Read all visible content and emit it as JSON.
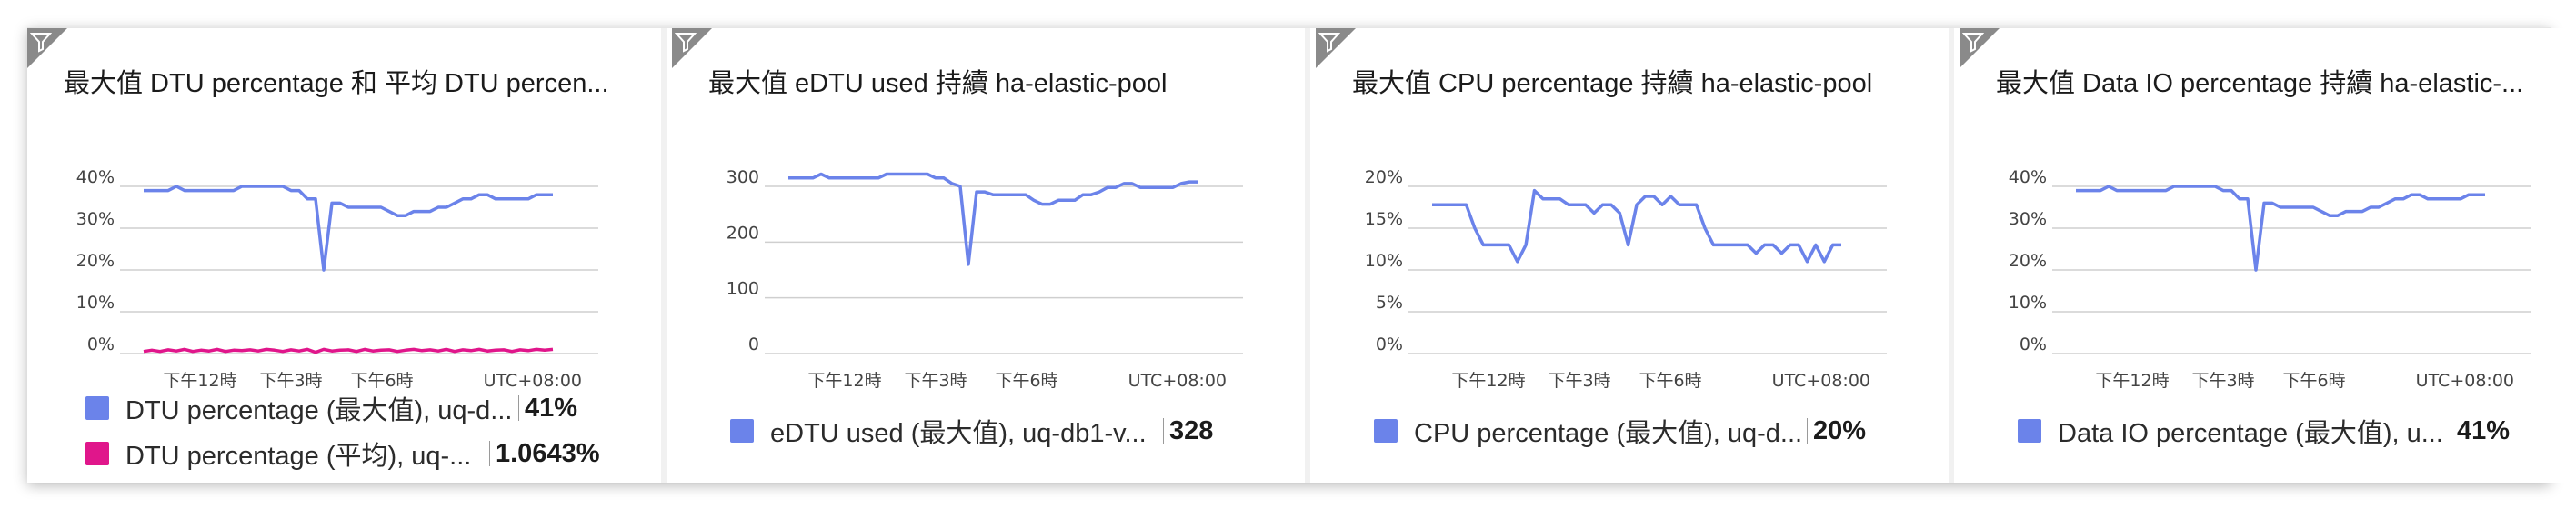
{
  "colors": {
    "primary": "#6b83ea",
    "pink": "#e0168b",
    "grid": "#cfcfcf"
  },
  "icons": {
    "filter": "filter-icon"
  },
  "chart_data": [
    {
      "type": "line",
      "title": "最大值 DTU percentage 和 平均 DTU percen...",
      "x_tick_labels": [
        "下午12時",
        "下午3時",
        "下午6時"
      ],
      "timezone_label": "UTC+08:00",
      "y_tick_labels": [
        "40%",
        "30%",
        "20%",
        "10%",
        "0%"
      ],
      "ylim": [
        0,
        40
      ],
      "x": [
        0,
        1,
        2,
        3,
        4,
        5,
        6,
        7,
        8,
        9,
        10,
        11,
        12,
        13,
        14,
        15,
        16,
        17,
        18,
        19,
        20,
        21,
        22,
        23,
        24,
        25,
        26,
        27,
        28,
        29,
        30,
        31,
        32,
        33,
        34,
        35,
        36,
        37,
        38,
        39,
        40,
        41,
        42,
        43,
        44,
        45,
        46,
        47,
        48,
        49,
        50
      ],
      "series": [
        {
          "name": "DTU percentage (最大值), uq-d...",
          "color": "#6b83ea",
          "legend_value": "41%",
          "values": [
            39,
            39,
            39,
            39,
            40,
            39,
            39,
            39,
            39,
            39,
            39,
            39,
            40,
            40,
            40,
            40,
            40,
            40,
            39,
            39,
            37,
            37,
            20,
            36,
            36,
            35,
            35,
            35,
            35,
            35,
            34,
            33,
            33,
            34,
            34,
            34,
            35,
            35,
            36,
            37,
            37,
            38,
            38,
            37,
            37,
            37,
            37,
            37,
            38,
            38,
            38
          ]
        },
        {
          "name": "DTU percentage (平均), uq-...",
          "color": "#e0168b",
          "legend_value": "1.0643%",
          "values": [
            0.5,
            0.8,
            0.5,
            0.9,
            0.6,
            1.0,
            0.5,
            0.8,
            0.6,
            1.0,
            0.5,
            0.8,
            0.7,
            0.9,
            0.6,
            1.0,
            0.8,
            0.5,
            0.9,
            0.6,
            1.0,
            0.3,
            1.0,
            0.6,
            0.8,
            0.9,
            0.5,
            1.0,
            0.6,
            0.8,
            0.9,
            0.5,
            0.8,
            1.0,
            0.7,
            0.9,
            0.6,
            1.0,
            0.5,
            0.9,
            0.7,
            1.0,
            0.6,
            0.8,
            0.9,
            0.5,
            0.9,
            0.7,
            1.0,
            0.8,
            1.0
          ]
        }
      ]
    },
    {
      "type": "line",
      "title": "最大值 eDTU used 持續 ha-elastic-pool",
      "x_tick_labels": [
        "下午12時",
        "下午3時",
        "下午6時"
      ],
      "timezone_label": "UTC+08:00",
      "y_tick_labels": [
        "300",
        "200",
        "100",
        "0"
      ],
      "ylim": [
        0,
        300
      ],
      "x": [
        0,
        1,
        2,
        3,
        4,
        5,
        6,
        7,
        8,
        9,
        10,
        11,
        12,
        13,
        14,
        15,
        16,
        17,
        18,
        19,
        20,
        21,
        22,
        23,
        24,
        25,
        26,
        27,
        28,
        29,
        30,
        31,
        32,
        33,
        34,
        35,
        36,
        37,
        38,
        39,
        40,
        41,
        42,
        43,
        44,
        45,
        46,
        47,
        48,
        49,
        50
      ],
      "series": [
        {
          "name": "eDTU used (最大值), uq-db1-v...",
          "color": "#6b83ea",
          "legend_value": "328",
          "values": [
            315,
            315,
            315,
            315,
            322,
            315,
            315,
            315,
            315,
            315,
            315,
            315,
            322,
            322,
            322,
            322,
            322,
            322,
            315,
            315,
            305,
            300,
            160,
            290,
            290,
            285,
            285,
            285,
            285,
            285,
            275,
            268,
            268,
            275,
            275,
            275,
            285,
            285,
            290,
            298,
            298,
            305,
            305,
            298,
            298,
            298,
            298,
            298,
            305,
            308,
            308
          ]
        }
      ]
    },
    {
      "type": "line",
      "title": "最大值 CPU percentage 持續 ha-elastic-pool",
      "x_tick_labels": [
        "下午12時",
        "下午3時",
        "下午6時"
      ],
      "timezone_label": "UTC+08:00",
      "y_tick_labels": [
        "20%",
        "15%",
        "10%",
        "5%",
        "0%"
      ],
      "ylim": [
        0,
        20
      ],
      "x": [
        0,
        1,
        2,
        3,
        4,
        5,
        6,
        7,
        8,
        9,
        10,
        11,
        12,
        13,
        14,
        15,
        16,
        17,
        18,
        19,
        20,
        21,
        22,
        23,
        24,
        25,
        26,
        27,
        28,
        29,
        30,
        31,
        32,
        33,
        34,
        35,
        36,
        37,
        38,
        39,
        40,
        41,
        42,
        43,
        44,
        45,
        46,
        47,
        48
      ],
      "series": [
        {
          "name": "CPU percentage (最大值), uq-d...",
          "color": "#6b83ea",
          "legend_value": "20%",
          "values": [
            17.8,
            17.8,
            17.8,
            17.8,
            17.8,
            15,
            13,
            13,
            13,
            13,
            11,
            13,
            19.5,
            18.5,
            18.5,
            18.5,
            17.8,
            17.8,
            17.8,
            16.8,
            17.8,
            17.8,
            16.8,
            13,
            17.8,
            18.8,
            18.8,
            17.8,
            18.8,
            17.8,
            17.8,
            17.8,
            15,
            13,
            13,
            13,
            13,
            13,
            12,
            13,
            13,
            12,
            13,
            13,
            11,
            13,
            11,
            13,
            13
          ]
        }
      ]
    },
    {
      "type": "line",
      "title": "最大值 Data IO percentage 持續 ha-elastic-...",
      "x_tick_labels": [
        "下午12時",
        "下午3時",
        "下午6時"
      ],
      "timezone_label": "UTC+08:00",
      "y_tick_labels": [
        "40%",
        "30%",
        "20%",
        "10%",
        "0%"
      ],
      "ylim": [
        0,
        40
      ],
      "x": [
        0,
        1,
        2,
        3,
        4,
        5,
        6,
        7,
        8,
        9,
        10,
        11,
        12,
        13,
        14,
        15,
        16,
        17,
        18,
        19,
        20,
        21,
        22,
        23,
        24,
        25,
        26,
        27,
        28,
        29,
        30,
        31,
        32,
        33,
        34,
        35,
        36,
        37,
        38,
        39,
        40,
        41,
        42,
        43,
        44,
        45,
        46,
        47,
        48,
        49,
        50
      ],
      "series": [
        {
          "name": "Data IO percentage (最大值), u...",
          "color": "#6b83ea",
          "legend_value": "41%",
          "values": [
            39,
            39,
            39,
            39,
            40,
            39,
            39,
            39,
            39,
            39,
            39,
            39,
            40,
            40,
            40,
            40,
            40,
            40,
            39,
            39,
            37,
            37,
            20,
            36,
            36,
            35,
            35,
            35,
            35,
            35,
            34,
            33,
            33,
            34,
            34,
            34,
            35,
            35,
            36,
            37,
            37,
            38,
            38,
            37,
            37,
            37,
            37,
            37,
            38,
            38,
            38
          ]
        }
      ]
    }
  ]
}
